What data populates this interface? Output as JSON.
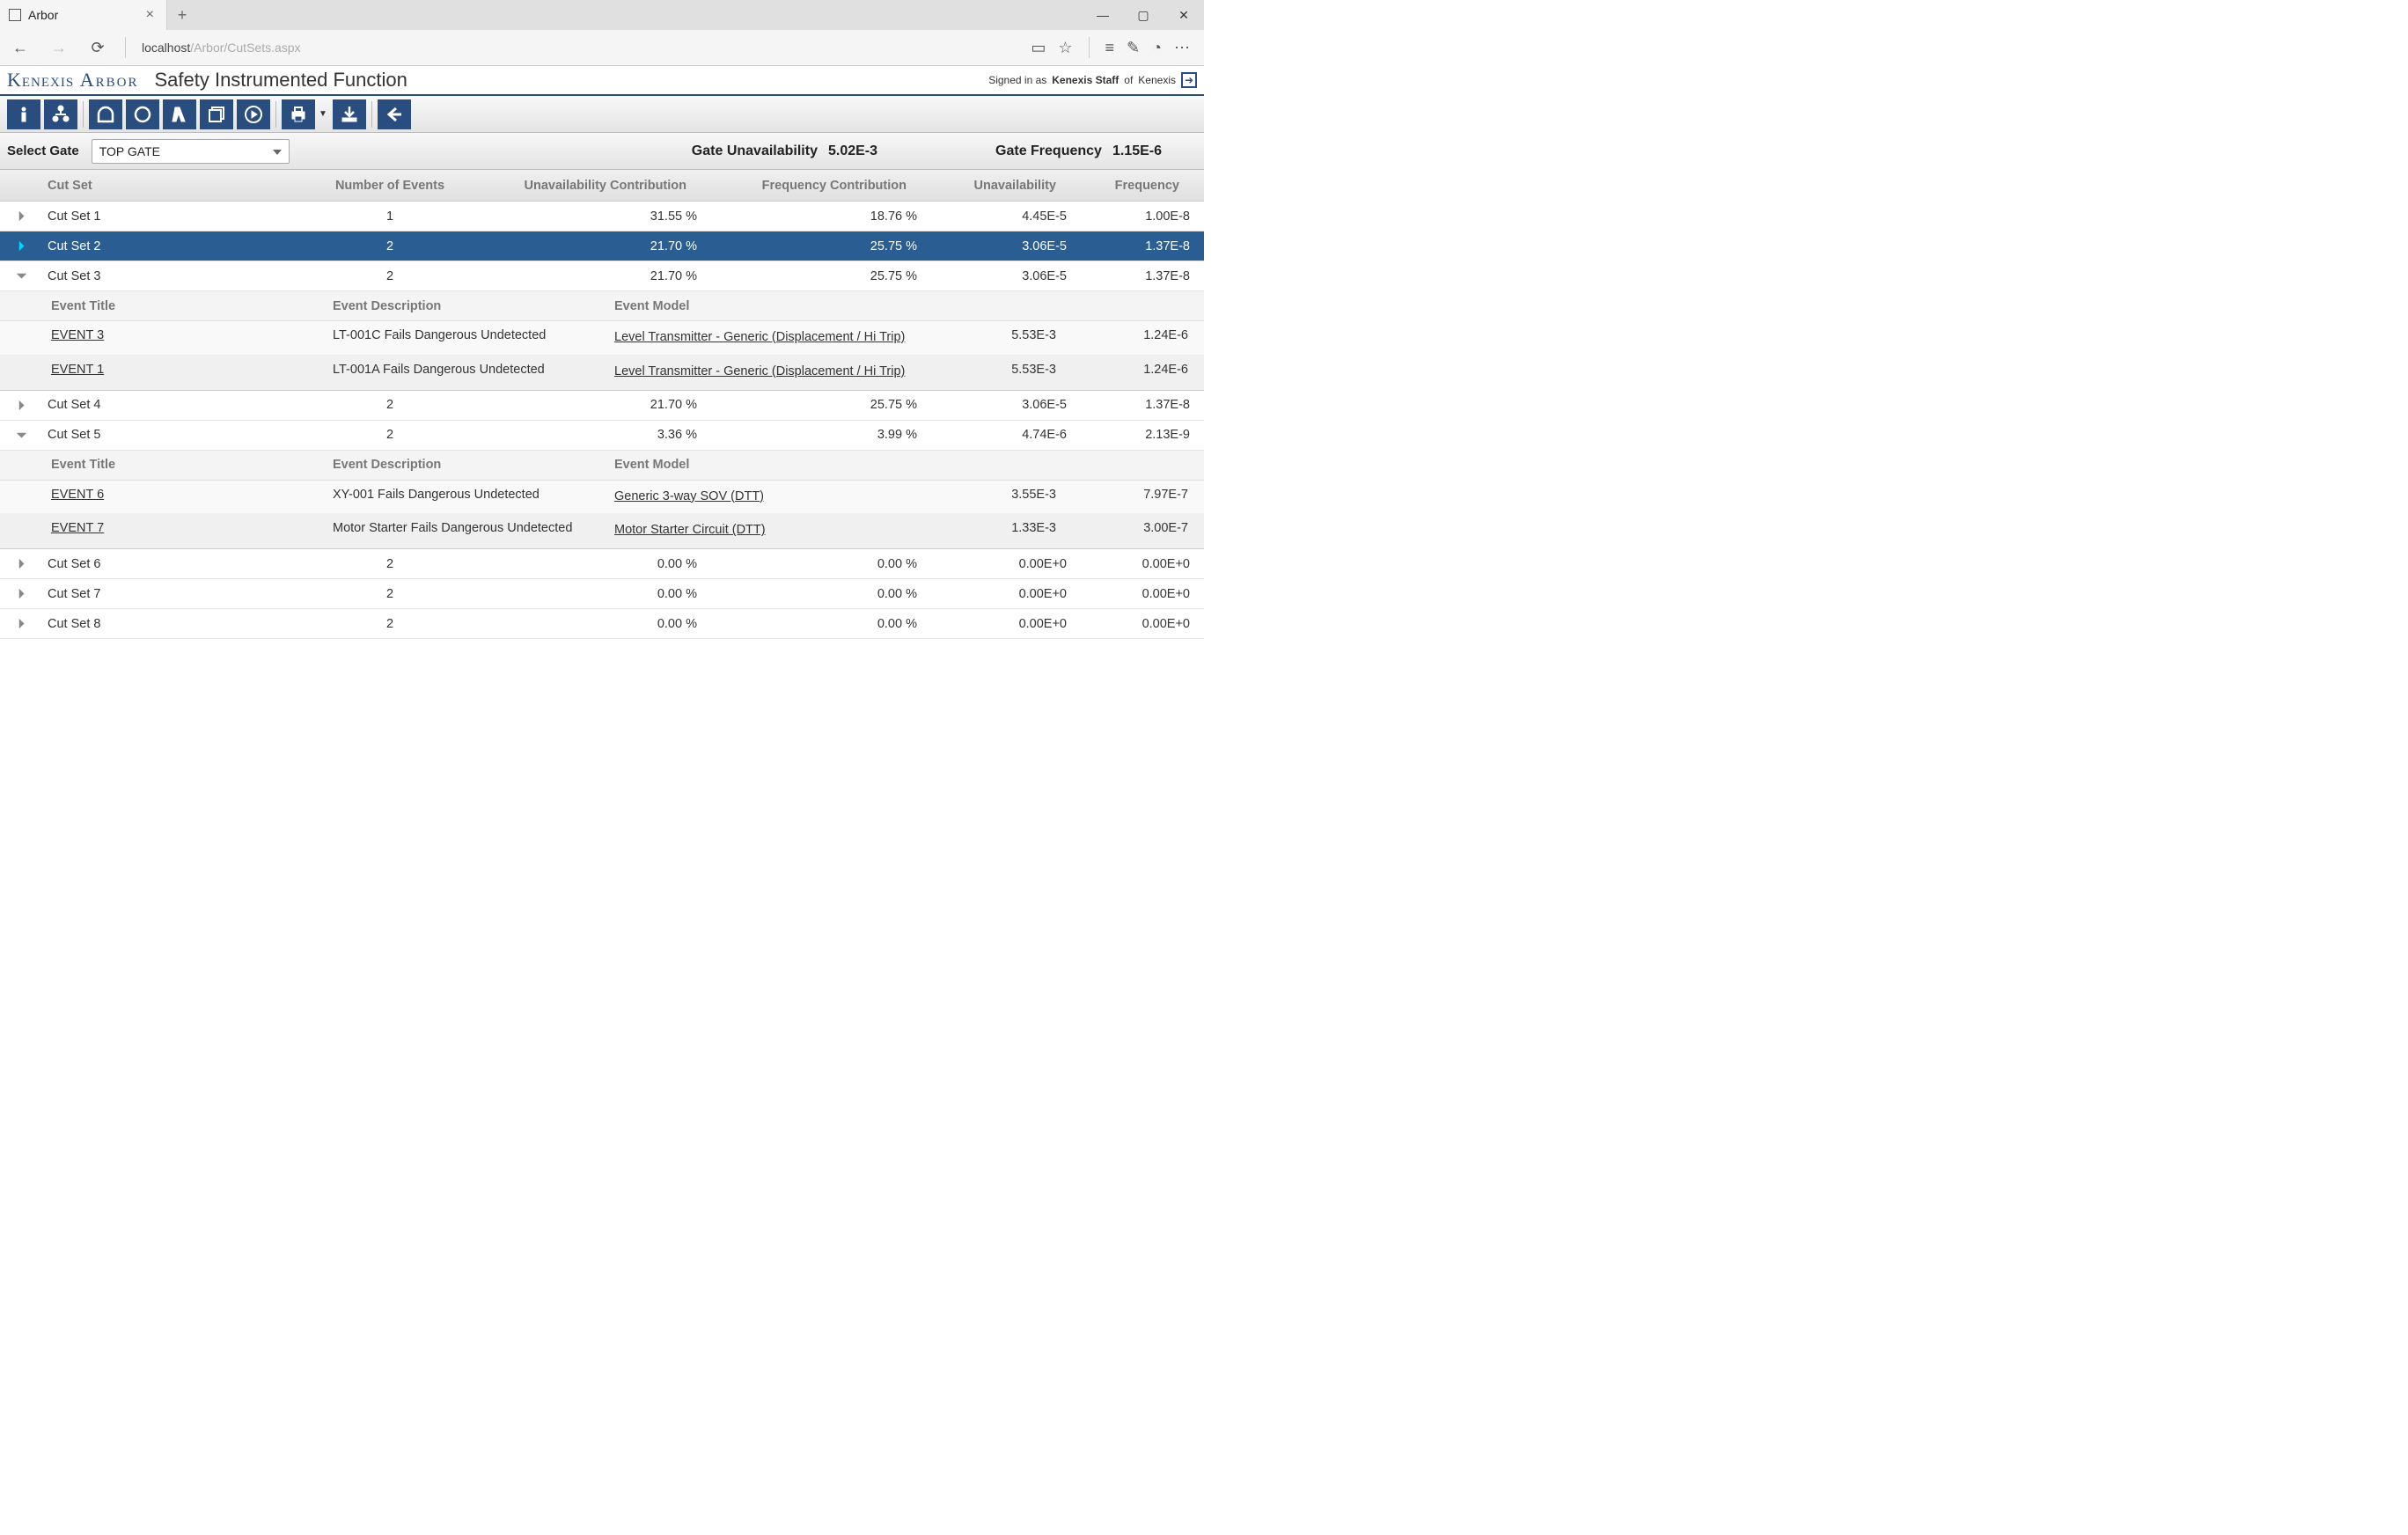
{
  "browser": {
    "tab_title": "Arbor",
    "url_host": "localhost",
    "url_path": "/Arbor/CutSets.aspx"
  },
  "header": {
    "brand_left": "Kenexis",
    "brand_right": "Arbor",
    "page_title": "Safety Instrumented Function",
    "signin_prefix": "Signed in as ",
    "signin_user": "Kenexis Staff",
    "signin_mid": " of ",
    "signin_org": "Kenexis"
  },
  "toolbar": {
    "icons": [
      "info",
      "fault-tree",
      "gate-and",
      "gate-or",
      "lambda",
      "layers",
      "play",
      "print",
      "download",
      "back"
    ]
  },
  "filter": {
    "select_gate_label": "Select Gate",
    "gate_value": "TOP GATE",
    "gate_unavail_label": "Gate Unavailability",
    "gate_unavail_value": "5.02E-3",
    "gate_freq_label": "Gate Frequency",
    "gate_freq_value": "1.15E-6"
  },
  "grid": {
    "headers": {
      "cutset": "Cut Set",
      "num_events": "Number of Events",
      "unavail_contrib": "Unavailability Contribution",
      "freq_contrib": "Frequency Contribution",
      "unavail": "Unavailability",
      "freq": "Frequency"
    },
    "sub_headers": {
      "event_title": "Event Title",
      "event_desc": "Event Description",
      "event_model": "Event Model"
    },
    "rows": [
      {
        "expand": "right",
        "name": "Cut Set 1",
        "num": "1",
        "uc": "31.55 %",
        "fc": "18.76 %",
        "u": "4.45E-5",
        "f": "1.00E-8",
        "selected": false
      },
      {
        "expand": "right-sel",
        "name": "Cut Set 2",
        "num": "2",
        "uc": "21.70 %",
        "fc": "25.75 %",
        "u": "3.06E-5",
        "f": "1.37E-8",
        "selected": true
      },
      {
        "expand": "down",
        "name": "Cut Set 3",
        "num": "2",
        "uc": "21.70 %",
        "fc": "25.75 %",
        "u": "3.06E-5",
        "f": "1.37E-8",
        "selected": false,
        "events": [
          {
            "title": "EVENT 3",
            "desc": "LT-001C Fails Dangerous Undetected",
            "model": "Level Transmitter - Generic (Displacement / Hi Trip)",
            "u": "5.53E-3",
            "f": "1.24E-6"
          },
          {
            "title": "EVENT 1",
            "desc": "LT-001A Fails Dangerous Undetected",
            "model": "Level Transmitter - Generic (Displacement / Hi Trip)",
            "u": "5.53E-3",
            "f": "1.24E-6"
          }
        ]
      },
      {
        "expand": "right",
        "name": "Cut Set 4",
        "num": "2",
        "uc": "21.70 %",
        "fc": "25.75 %",
        "u": "3.06E-5",
        "f": "1.37E-8",
        "selected": false
      },
      {
        "expand": "down",
        "name": "Cut Set 5",
        "num": "2",
        "uc": "3.36 %",
        "fc": "3.99 %",
        "u": "4.74E-6",
        "f": "2.13E-9",
        "selected": false,
        "events": [
          {
            "title": "EVENT 6",
            "desc": "XY-001 Fails Dangerous Undetected",
            "model": "Generic 3-way SOV (DTT)",
            "u": "3.55E-3",
            "f": "7.97E-7"
          },
          {
            "title": "EVENT 7",
            "desc": "Motor Starter Fails Dangerous Undetected",
            "model": "Motor Starter Circuit (DTT)",
            "u": "1.33E-3",
            "f": "3.00E-7"
          }
        ]
      },
      {
        "expand": "right",
        "name": "Cut Set 6",
        "num": "2",
        "uc": "0.00 %",
        "fc": "0.00 %",
        "u": "0.00E+0",
        "f": "0.00E+0",
        "selected": false
      },
      {
        "expand": "right",
        "name": "Cut Set 7",
        "num": "2",
        "uc": "0.00 %",
        "fc": "0.00 %",
        "u": "0.00E+0",
        "f": "0.00E+0",
        "selected": false
      },
      {
        "expand": "right",
        "name": "Cut Set 8",
        "num": "2",
        "uc": "0.00 %",
        "fc": "0.00 %",
        "u": "0.00E+0",
        "f": "0.00E+0",
        "selected": false
      }
    ]
  }
}
